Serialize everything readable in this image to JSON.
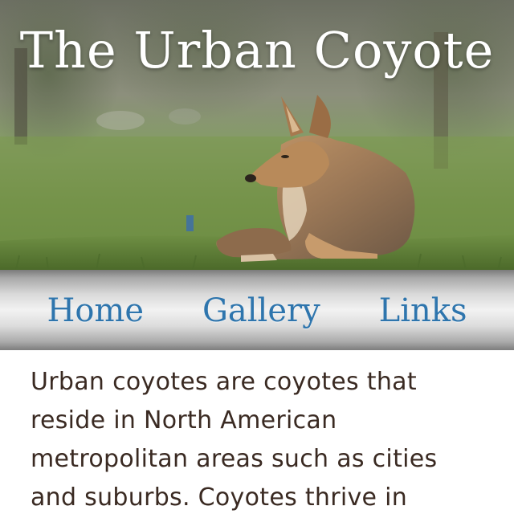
{
  "header": {
    "title": "The Urban Coyote"
  },
  "nav": {
    "items": [
      {
        "label": "Home"
      },
      {
        "label": "Gallery"
      },
      {
        "label": "Links"
      }
    ],
    "link_color": "#2e75ad"
  },
  "main": {
    "paragraph": "Urban coyotes are coyotes that reside in North American metropolitan areas such as cities and suburbs. Coyotes thrive in"
  },
  "hero": {
    "image": "coyote-photo"
  }
}
